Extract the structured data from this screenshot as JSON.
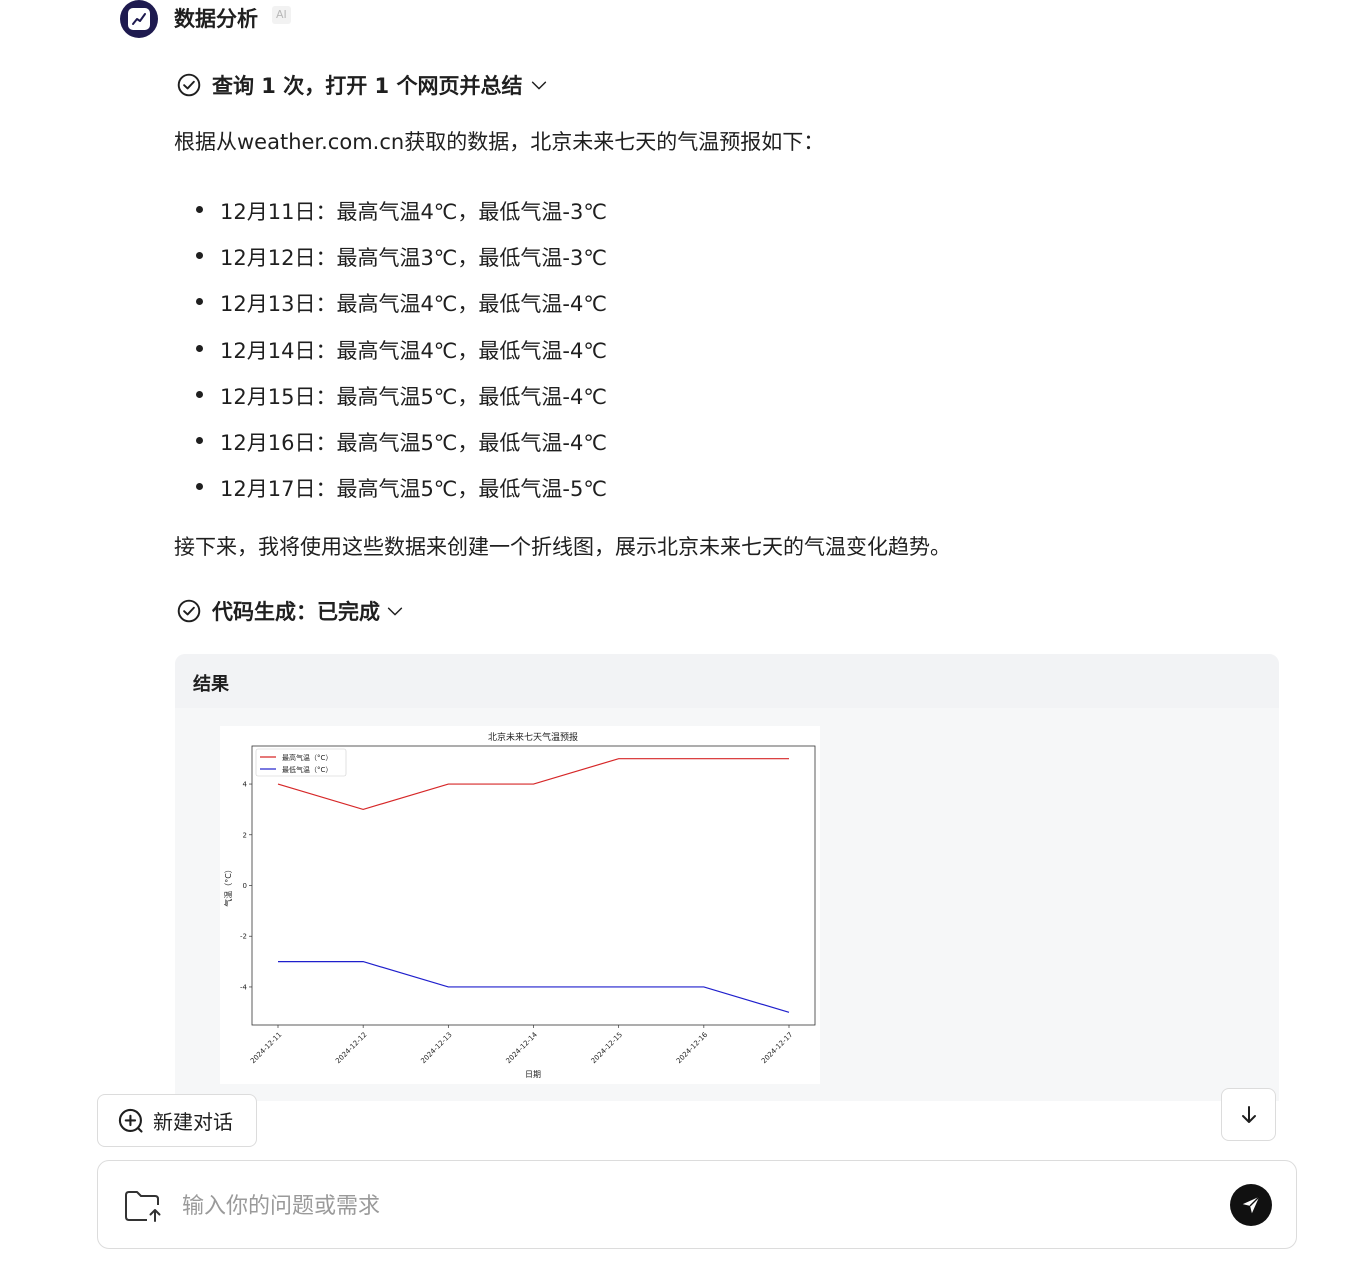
{
  "agent": {
    "name": "数据分析",
    "badge": "AI"
  },
  "step1": {
    "title": "查询 1 次，打开 1 个网页并总结"
  },
  "intro": "根据从weather.com.cn获取的数据，北京未来七天的气温预报如下：",
  "forecast": [
    "12月11日：最高气温4℃，最低气温-3℃",
    "12月12日：最高气温3℃，最低气温-3℃",
    "12月13日：最高气温4℃，最低气温-4℃",
    "12月14日：最高气温4℃，最低气温-4℃",
    "12月15日：最高气温5℃，最低气温-4℃",
    "12月16日：最高气温5℃，最低气温-4℃",
    "12月17日：最高气温5℃，最低气温-5℃"
  ],
  "summary": "接下来，我将使用这些数据来创建一个折线图，展示北京未来七天的气温变化趋势。",
  "step2": {
    "title": "代码生成：已完成"
  },
  "result": {
    "title": "结果"
  },
  "chart_data": {
    "type": "line",
    "title": "北京未来七天气温预报",
    "xlabel": "日期",
    "ylabel": "气温（°C）",
    "x": [
      "2024-12-11",
      "2024-12-12",
      "2024-12-13",
      "2024-12-14",
      "2024-12-15",
      "2024-12-16",
      "2024-12-17"
    ],
    "series": [
      {
        "name": "最高气温（°C）",
        "color": "#d62728",
        "values": [
          4,
          3,
          4,
          4,
          5,
          5,
          5
        ]
      },
      {
        "name": "最低气温（°C）",
        "color": "#1f1fcc",
        "values": [
          -3,
          -3,
          -4,
          -4,
          -4,
          -4,
          -5
        ]
      }
    ],
    "ylim": [
      -5.5,
      5.5
    ],
    "yticks": [
      4,
      2,
      0,
      -2,
      -4
    ],
    "legend": "top-left",
    "grid": false
  },
  "new_chat": {
    "label": "新建对话"
  },
  "chat_input": {
    "placeholder": "输入你的问题或需求"
  },
  "icons": {
    "avatar": "chart-icon",
    "step": "check-circle-icon",
    "expand": "chevron-down-icon",
    "new_chat": "plus-circle-icon",
    "scroll": "arrow-down-icon",
    "attach": "folder-upload-icon",
    "send": "send-icon"
  }
}
